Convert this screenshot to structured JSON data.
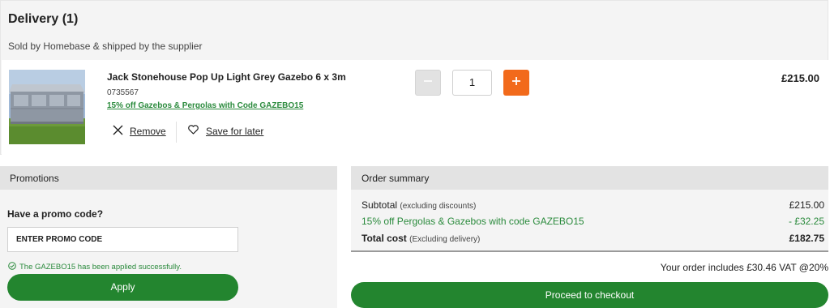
{
  "delivery": {
    "title": "Delivery (1)",
    "sold_by": "Sold by Homebase & shipped by the supplier"
  },
  "item": {
    "name": "Jack Stonehouse Pop Up Light Grey Gazebo 6 x 3m",
    "code": "0735567",
    "promo": "15% off Gazebos & Pergolas with Code GAZEBO15",
    "remove_label": "Remove",
    "save_label": "Save for later",
    "quantity": "1",
    "price": "£215.00",
    "image_icon": "gazebo-product-photo"
  },
  "promotions": {
    "title": "Promotions",
    "question": "Have a promo code?",
    "input_value": "ENTER PROMO CODE",
    "success": "The GAZEBO15 has been applied successfully.",
    "apply_label": "Apply"
  },
  "summary": {
    "title": "Order summary",
    "subtotal_label": "Subtotal",
    "subtotal_note": "(excluding discounts)",
    "subtotal_value": "£215.00",
    "discount_label": "15% off Pergolas & Gazebos with code GAZEBO15",
    "discount_value": "- £32.25",
    "total_label": "Total cost",
    "total_note": "(Excluding delivery)",
    "total_value": "£182.75",
    "vat_note": "Your order includes £30.46 VAT @20%",
    "checkout_label": "Proceed to checkout"
  },
  "colors": {
    "accent_green": "#23852f",
    "promo_green": "#2a8a3c",
    "plus_orange": "#f26a1b"
  }
}
